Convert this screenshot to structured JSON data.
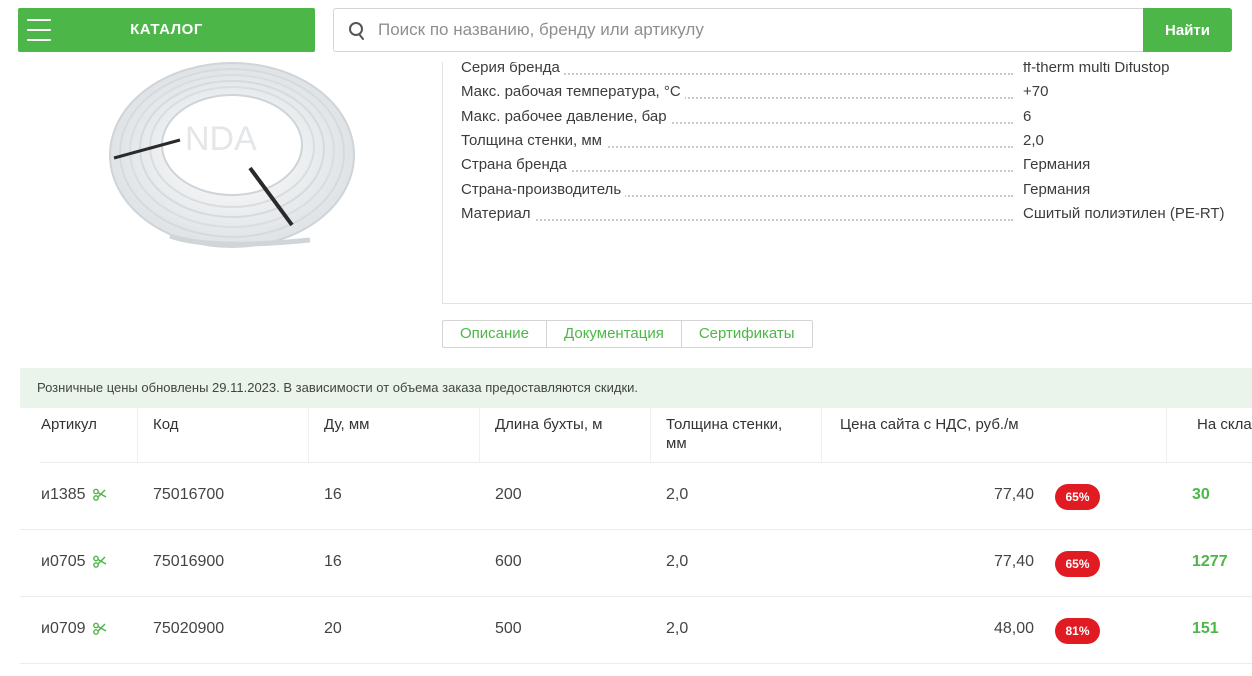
{
  "header": {
    "catalog_label": "КАТАЛОГ",
    "search_placeholder": "Поиск по названию, бренду или артикулу",
    "search_value": "",
    "search_button": "Найти",
    "accent_color": "#4cb748"
  },
  "product_image": {
    "watermark": "NDA"
  },
  "specs": [
    {
      "label": "Серия бренда",
      "value": "ff-therm multi Difustop"
    },
    {
      "label": "Макс. рабочая температура, °C",
      "value": "+70"
    },
    {
      "label": "Макс. рабочее давление, бар",
      "value": "6"
    },
    {
      "label": "Толщина стенки, мм",
      "value": "2,0"
    },
    {
      "label": "Страна бренда",
      "value": "Германия"
    },
    {
      "label": "Страна-производитель",
      "value": "Германия"
    },
    {
      "label": "Материал",
      "value": "Сшитый полиэтилен (PE-RT)"
    }
  ],
  "tabs": [
    {
      "label": "Описание"
    },
    {
      "label": "Документация"
    },
    {
      "label": "Сертификаты"
    }
  ],
  "notice": "Розничные цены обновлены 29.11.2023. В зависимости от объема заказа предоставляются скидки.",
  "table": {
    "headers": {
      "article": "Артикул",
      "code": "Код",
      "du": "Ду, мм",
      "length": "Длина бухты, м",
      "thickness_line1": "Толщина стенки,",
      "thickness_line2": "мм",
      "price": "Цена сайта с НДС, руб./м",
      "stock": "На скла"
    },
    "rows": [
      {
        "article": "и1385",
        "code": "75016700",
        "du": "16",
        "length": "200",
        "thickness": "2,0",
        "price": "77,40",
        "discount": "65%",
        "stock": "30"
      },
      {
        "article": "и0705",
        "code": "75016900",
        "du": "16",
        "length": "600",
        "thickness": "2,0",
        "price": "77,40",
        "discount": "65%",
        "stock": "1277"
      },
      {
        "article": "и0709",
        "code": "75020900",
        "du": "20",
        "length": "500",
        "thickness": "2,0",
        "price": "48,00",
        "discount": "81%",
        "stock": "151"
      }
    ],
    "discount_color": "#e01b22",
    "stock_color": "#4cb748"
  }
}
